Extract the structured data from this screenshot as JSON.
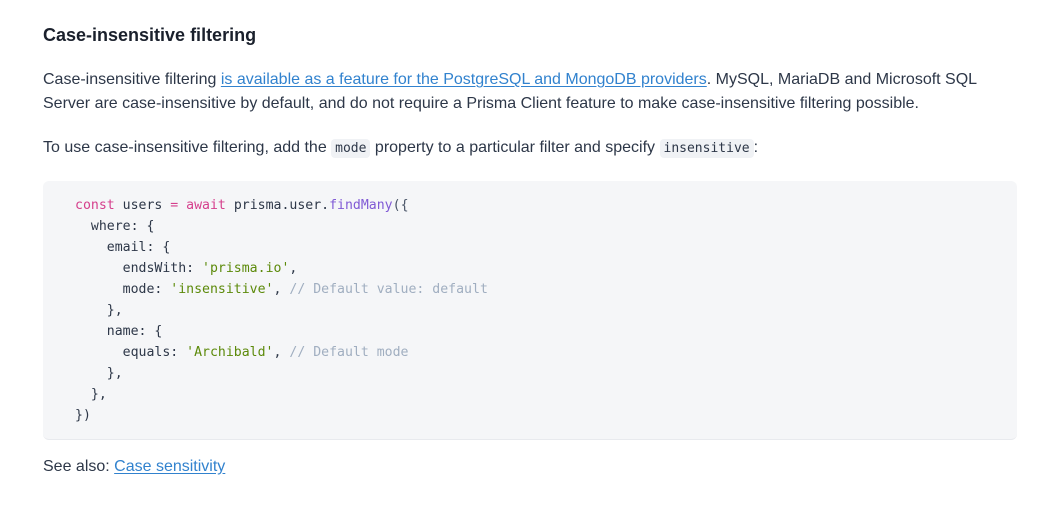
{
  "section": {
    "title": "Case-insensitive filtering"
  },
  "intro": {
    "lead": "Case-insensitive filtering ",
    "link": "is available as a feature for the PostgreSQL and MongoDB providers",
    "rest": ". MySQL, MariaDB and Microsoft SQL Server are case-insensitive by default, and do not require a Prisma Client feature to make case-insensitive filtering possible."
  },
  "usage": {
    "text1": "To use case-insensitive filtering, add the ",
    "code1": "mode",
    "text2": " property to a particular filter and specify ",
    "code2": "insensitive",
    "text3": ":"
  },
  "code": {
    "l1_const": "const",
    "l1_var": " users ",
    "l1_eq": "=",
    "l1_await": " await",
    "l1_obj": " prisma.user.",
    "l1_fn": "findMany",
    "l1_end": "({",
    "l2": "  where: {",
    "l3": "    email: {",
    "l4_key": "      endsWith: ",
    "l4_val": "'prisma.io'",
    "l4_end": ",",
    "l5_key": "      mode: ",
    "l5_val": "'insensitive'",
    "l5_end": ", ",
    "l5_cm": "// Default value: default",
    "l6": "    },",
    "l7": "    name: {",
    "l8_key": "      equals: ",
    "l8_val": "'Archibald'",
    "l8_end": ", ",
    "l8_cm": "// Default mode",
    "l9": "    },",
    "l10": "  },",
    "l11": "})"
  },
  "see_also": {
    "label": "See also: ",
    "link": "Case sensitivity"
  }
}
